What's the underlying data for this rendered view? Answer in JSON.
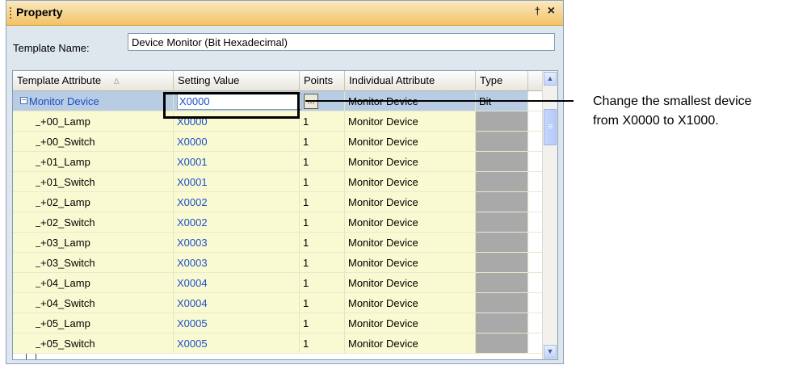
{
  "panel": {
    "title": "Property",
    "pin_glyph": "†",
    "close_glyph": "×"
  },
  "template_name": {
    "label": "Template Name:",
    "value": "Device Monitor (Bit Hexadecimal)"
  },
  "grid": {
    "headers": [
      "Template Attribute",
      "Setting Value",
      "Points",
      "Individual Attribute",
      "Type"
    ],
    "sort_glyph": "∆",
    "root": {
      "expander": "−",
      "attribute": "Monitor Device",
      "setting_value": "X0000",
      "individual_attribute": "Monitor Device",
      "type": "Bit",
      "ellipsis": "..."
    },
    "rows": [
      {
        "attribute": "+00_Lamp",
        "setting_value": "X0000",
        "points": "1",
        "individual_attribute": "Monitor Device"
      },
      {
        "attribute": "+00_Switch",
        "setting_value": "X0000",
        "points": "1",
        "individual_attribute": "Monitor Device"
      },
      {
        "attribute": "+01_Lamp",
        "setting_value": "X0001",
        "points": "1",
        "individual_attribute": "Monitor Device"
      },
      {
        "attribute": "+01_Switch",
        "setting_value": "X0001",
        "points": "1",
        "individual_attribute": "Monitor Device"
      },
      {
        "attribute": "+02_Lamp",
        "setting_value": "X0002",
        "points": "1",
        "individual_attribute": "Monitor Device"
      },
      {
        "attribute": "+02_Switch",
        "setting_value": "X0002",
        "points": "1",
        "individual_attribute": "Monitor Device"
      },
      {
        "attribute": "+03_Lamp",
        "setting_value": "X0003",
        "points": "1",
        "individual_attribute": "Monitor Device"
      },
      {
        "attribute": "+03_Switch",
        "setting_value": "X0003",
        "points": "1",
        "individual_attribute": "Monitor Device"
      },
      {
        "attribute": "+04_Lamp",
        "setting_value": "X0004",
        "points": "1",
        "individual_attribute": "Monitor Device"
      },
      {
        "attribute": "+04_Switch",
        "setting_value": "X0004",
        "points": "1",
        "individual_attribute": "Monitor Device"
      },
      {
        "attribute": "+05_Lamp",
        "setting_value": "X0005",
        "points": "1",
        "individual_attribute": "Monitor Device"
      },
      {
        "attribute": "+05_Switch",
        "setting_value": "X0005",
        "points": "1",
        "individual_attribute": "Monitor Device"
      }
    ]
  },
  "scrollbar": {
    "up_glyph": "▲",
    "down_glyph": "▼"
  },
  "annotation": {
    "line1": "Change the smallest device",
    "line2": "from X0000 to X1000."
  },
  "colors": {
    "title_bar": "#f2c266",
    "panel_bg": "#dee6ee",
    "row_bg": "#fafad2",
    "selected_row": "#b8cce4",
    "type_cell": "#a9a9a9",
    "link_blue": "#1a4fc8"
  }
}
